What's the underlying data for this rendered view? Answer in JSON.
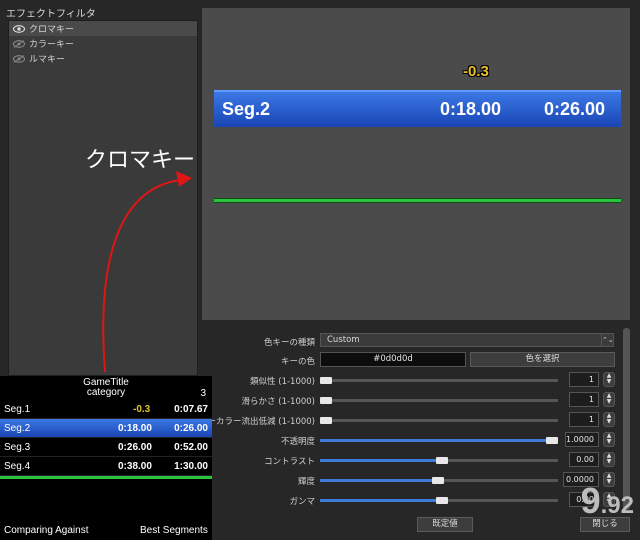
{
  "filters": {
    "title": "エフェクトフィルタ",
    "items": [
      {
        "label": "クロマキー",
        "visible": true
      },
      {
        "label": "カラーキー",
        "visible": false
      },
      {
        "label": "ルマキー",
        "visible": false
      }
    ]
  },
  "preview": {
    "delta": "-0.3",
    "segment": {
      "name": "Seg.2",
      "split_time": "0:18.00",
      "total_time": "0:26.00"
    }
  },
  "annotation": {
    "label": "クロマキー"
  },
  "properties": {
    "key_type_label": "色キーの種類",
    "key_type_value": "Custom",
    "key_color_label": "キーの色",
    "key_color_value": "#0d0d0d",
    "select_color_button": "色を選択",
    "similarity_label": "類似性 (1-1000)",
    "similarity_value": "1",
    "smoothness_label": "滑らかさ (1-1000)",
    "smoothness_value": "1",
    "spill_label": "キーカラー流出低減 (1-1000)",
    "spill_value": "1",
    "opacity_label": "不透明度",
    "opacity_value": "1.0000",
    "contrast_label": "コントラスト",
    "contrast_value": "0.00",
    "brightness_label": "輝度",
    "brightness_value": "0.0000",
    "gamma_label": "ガンマ",
    "gamma_value": "0.00",
    "defaults_button": "既定値",
    "close_button": "閉じる",
    "sliders": {
      "similarity": 0.0,
      "smoothness": 0.0,
      "spill": 0.0,
      "opacity": 1.0,
      "contrast": 0.5,
      "brightness": 0.5,
      "gamma": 0.5
    }
  },
  "splits": {
    "game_title": "GameTitle",
    "category": "category",
    "attempts": "3",
    "rows": [
      {
        "name": "Seg.1",
        "delta": "-0.3",
        "time": "0:07.67",
        "current": false
      },
      {
        "name": "Seg.2",
        "delta": "0:18.00",
        "time": "0:26.00",
        "current": true
      },
      {
        "name": "Seg.3",
        "delta": "0:26.00",
        "time": "0:52.00",
        "current": false
      },
      {
        "name": "Seg.4",
        "delta": "0:38.00",
        "time": "1:30.00",
        "current": false
      }
    ],
    "timer_main": "9",
    "timer_fraction": ".92",
    "comparing_label": "Comparing Against",
    "comparison_value": "Best Segments"
  },
  "colors": {
    "delta_gold": "#e8c12a",
    "current_split": "#2d5fd0",
    "green_line": "#29c43b"
  }
}
